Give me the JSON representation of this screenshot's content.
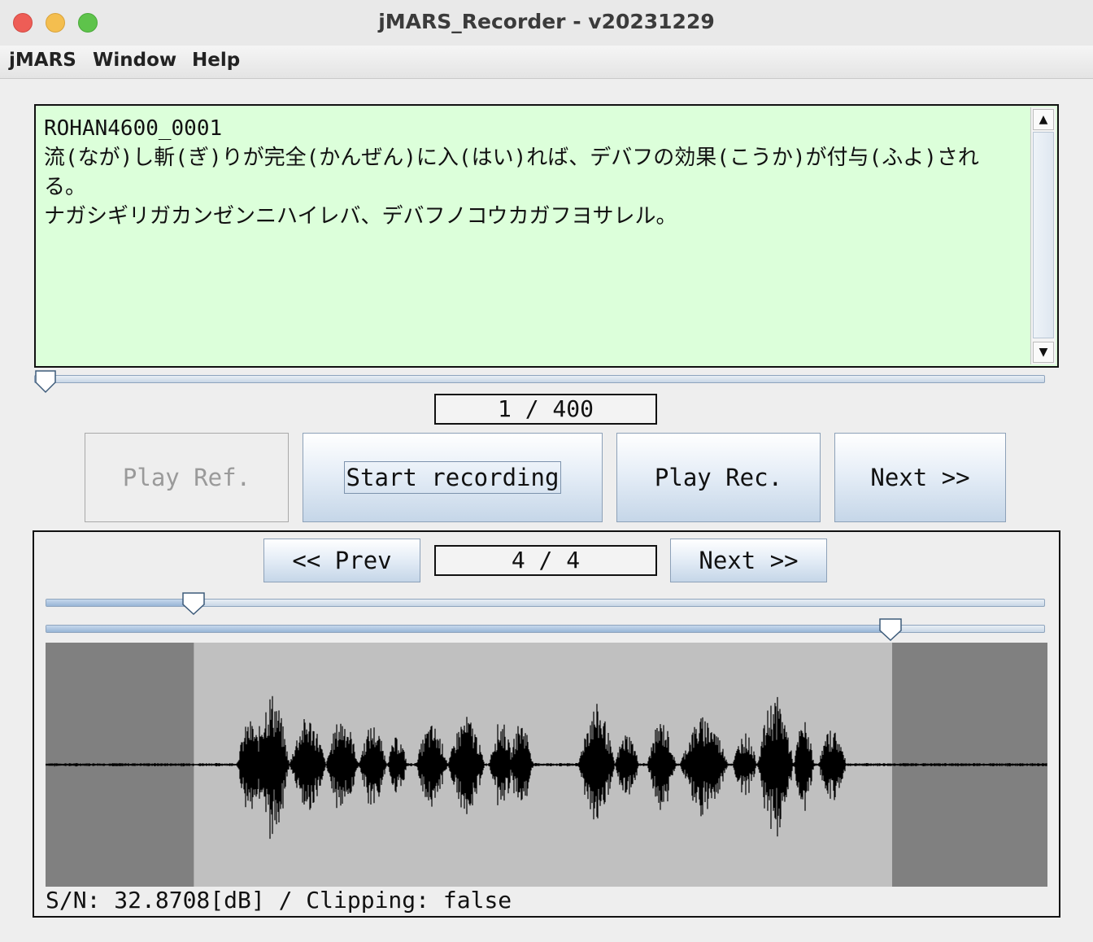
{
  "window": {
    "title": "jMARS_Recorder - v20231229"
  },
  "menu": [
    "jMARS",
    "Window",
    "Help"
  ],
  "script_text": {
    "lines": [
      "ROHAN4600_0001",
      "流(なが)し斬(ぎ)りが完全(かんぜん)に入(はい)れば、デバフの効果(こうか)が付与(ふよ)される。",
      "ナガシギリガカンゼンニハイレバ、デバフノコウカガフヨサレル。"
    ],
    "background": "#dcffda"
  },
  "sentence_slider": {
    "value": 1,
    "max": 400
  },
  "sentence_counter": "1 / 400",
  "buttons": {
    "play_ref": "Play Ref.",
    "start_recording": "Start recording",
    "play_rec": "Play Rec.",
    "next": "Next >>"
  },
  "take_nav": {
    "prev": "<< Prev",
    "counter": "4 / 4",
    "next": "Next >>"
  },
  "trim": {
    "start_fraction": 0.148,
    "end_fraction": 0.845
  },
  "status": "S/N: 32.8708[dB] / Clipping: false",
  "colors": {
    "waveform": "#000000",
    "selected_region": "#c0c0c0",
    "trimmed_region": "#808080"
  }
}
